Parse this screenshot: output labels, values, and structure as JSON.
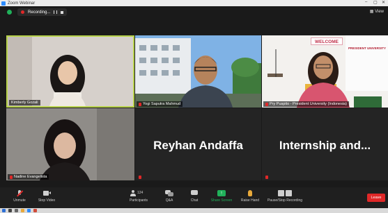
{
  "window": {
    "title": "Zoom Webinar"
  },
  "recording": {
    "label": "Recording..."
  },
  "view_label": "View",
  "participants": [
    {
      "name": "Kimberly Gozali"
    },
    {
      "name": "Yogi Saputra Mahmud"
    },
    {
      "name": "Pry Puspito - President University (Indonesia)"
    },
    {
      "name": "Nadine Evangelista"
    },
    {
      "name": "Reyhan Andaffa"
    },
    {
      "name": "Internship and..."
    }
  ],
  "toolbar": {
    "unmute": "Unmute",
    "stop_video": "Stop Video",
    "participants": "Participants",
    "participants_count": "124",
    "qa": "Q&A",
    "chat": "Chat",
    "share_screen": "Share Screen",
    "raise_hand": "Raise Hand",
    "pause_recording": "Pause/Stop Recording",
    "leave": "Leave"
  },
  "banner": {
    "welcome": "WELCOME",
    "university": "PRESIDENT UNIVERSITY"
  },
  "colors": {
    "active_speaker": "#b7d24a",
    "share": "#20b15a",
    "leave": "#e02828",
    "zoom_blue": "#2d8cff"
  }
}
